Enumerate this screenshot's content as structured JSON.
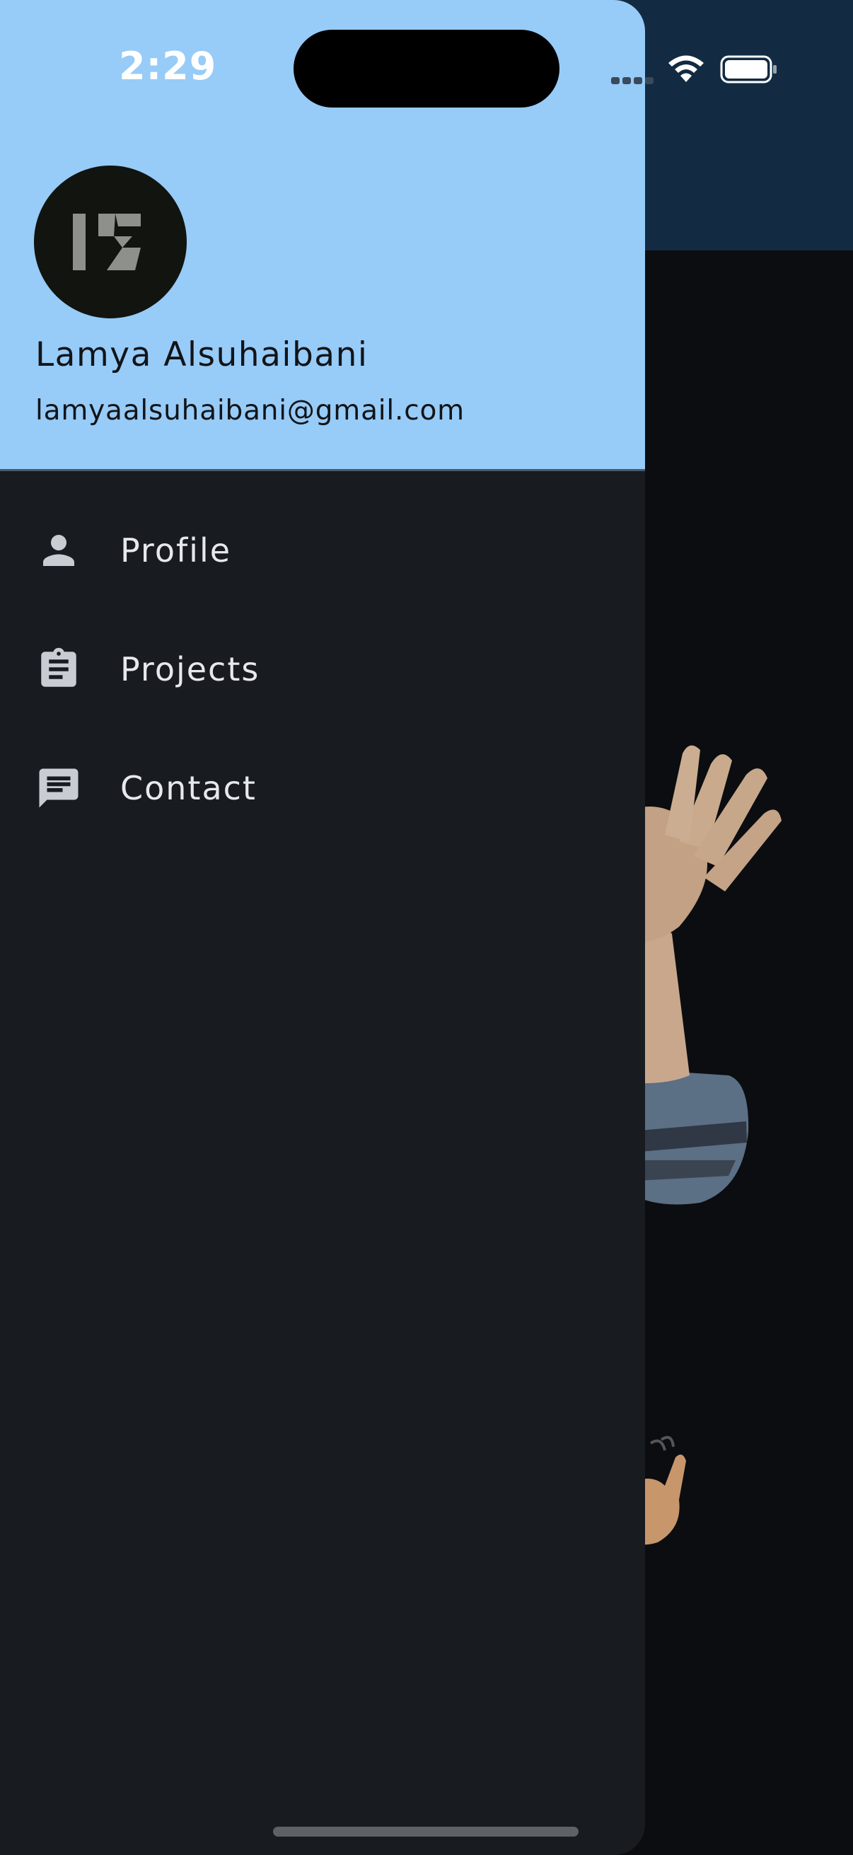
{
  "status_bar": {
    "time": "2:29"
  },
  "drawer": {
    "header": {
      "avatar_initials": "LS",
      "name": "Lamya Alsuhaibani",
      "email": "lamyaalsuhaibani@gmail.com"
    },
    "menu": [
      {
        "label": "Profile",
        "icon": "person-icon"
      },
      {
        "label": "Projects",
        "icon": "clipboard-icon"
      },
      {
        "label": "Contact",
        "icon": "chat-icon"
      }
    ]
  },
  "colors": {
    "header_bg": "#97cbf8",
    "drawer_bg": "#181b20",
    "app_bar_bg": "#132b42",
    "icon": "#c9cdd3"
  }
}
